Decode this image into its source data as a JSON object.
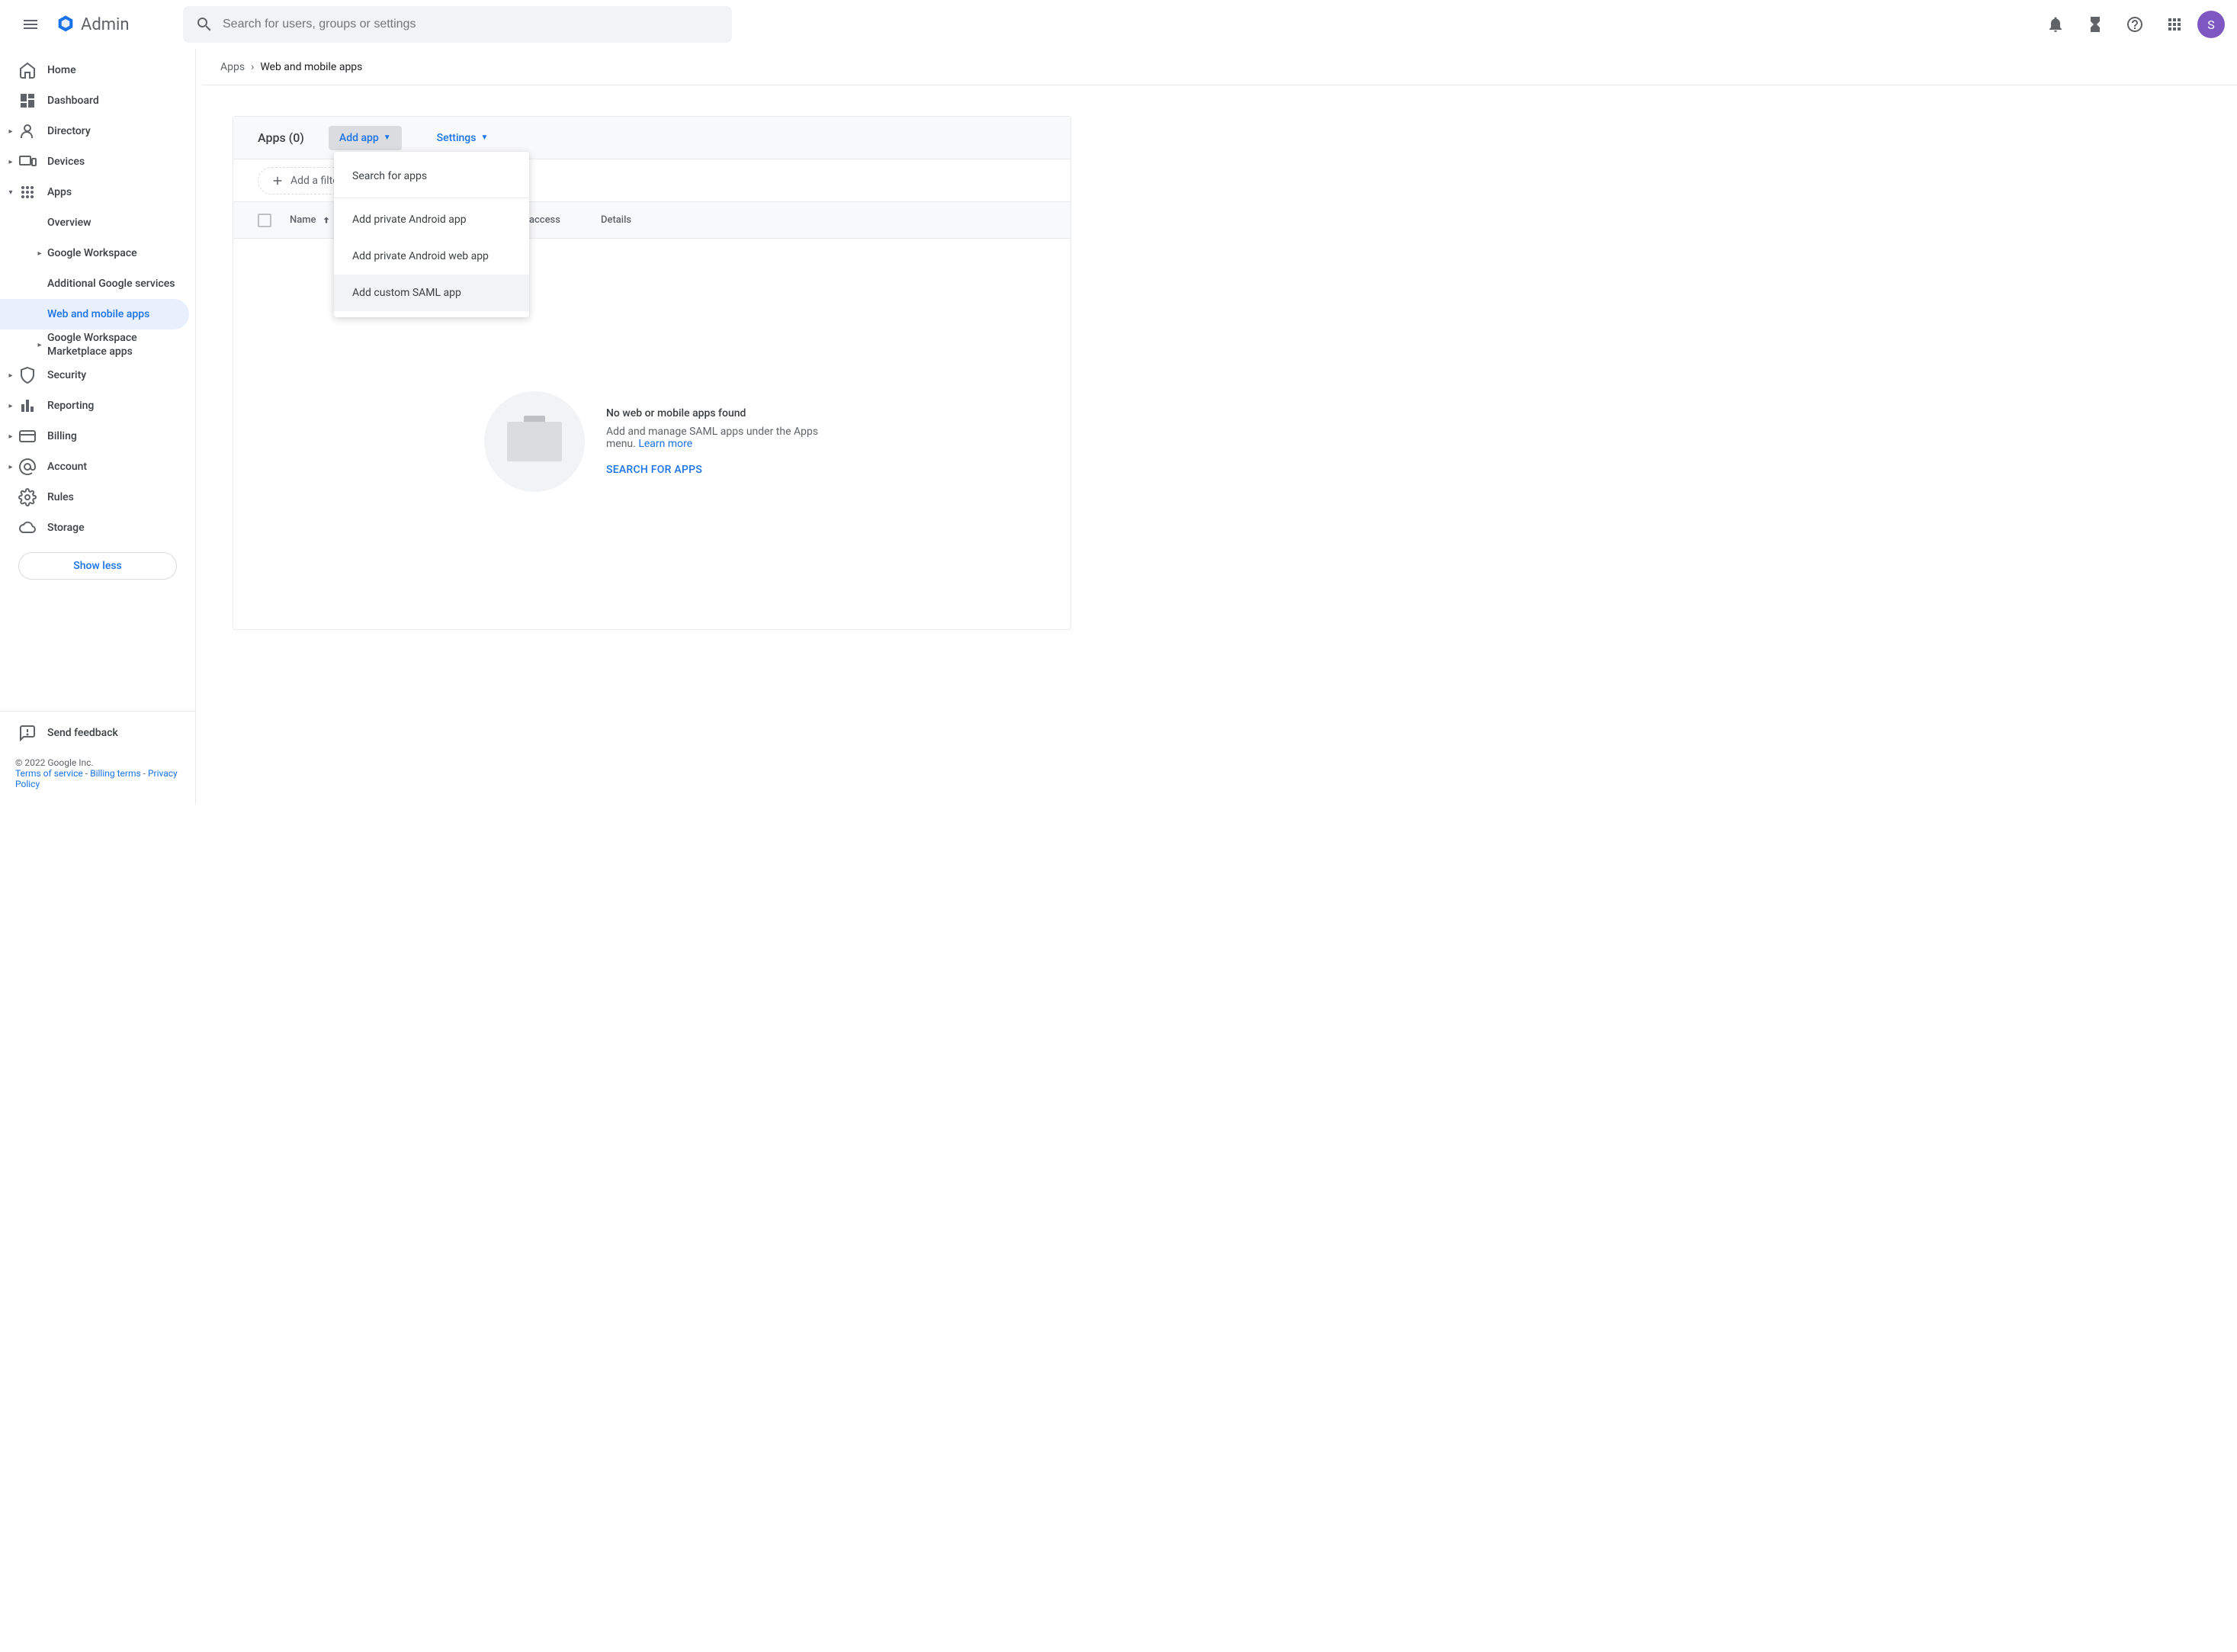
{
  "header": {
    "app_name": "Admin",
    "search_placeholder": "Search for users, groups or settings",
    "avatar_initial": "S"
  },
  "breadcrumb": {
    "root": "Apps",
    "current": "Web and mobile apps"
  },
  "sidebar": {
    "items": {
      "home": "Home",
      "dashboard": "Dashboard",
      "directory": "Directory",
      "devices": "Devices",
      "apps": "Apps",
      "security": "Security",
      "reporting": "Reporting",
      "billing": "Billing",
      "account": "Account",
      "rules": "Rules",
      "storage": "Storage"
    },
    "apps_children": {
      "overview": "Overview",
      "google_workspace": "Google Workspace",
      "additional": "Additional Google services",
      "web_mobile": "Web and mobile apps",
      "marketplace": "Google Workspace Marketplace apps"
    },
    "show_less": "Show less",
    "feedback": "Send feedback",
    "copyright": "© 2022 Google Inc.",
    "terms": "Terms of service",
    "billing_terms": "Billing terms",
    "privacy": "Privacy Policy"
  },
  "panel": {
    "title": "Apps (0)",
    "add_app": "Add app",
    "settings": "Settings",
    "add_filter": "Add a filter",
    "columns": {
      "name": "Name",
      "user_access": "User access",
      "details": "Details"
    },
    "empty": {
      "title": "No web or mobile apps found",
      "desc": "Add and manage SAML apps under the Apps menu. ",
      "learn_more": "Learn more",
      "cta": "SEARCH FOR APPS"
    }
  },
  "dropdown": {
    "search": "Search for apps",
    "android": "Add private Android app",
    "android_web": "Add private Android web app",
    "saml": "Add custom SAML app"
  }
}
